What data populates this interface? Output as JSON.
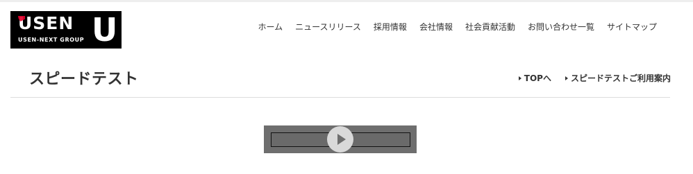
{
  "logo": {
    "brand": "USEN",
    "group": "USEN-NEXT GROUP",
    "mark": "U",
    "accent_color": "#e4002b"
  },
  "nav": {
    "items": [
      {
        "label": "ホーム"
      },
      {
        "label": "ニュースリリース"
      },
      {
        "label": "採用情報"
      },
      {
        "label": "会社情報"
      },
      {
        "label": "社会貢献活動"
      },
      {
        "label": "お問い合わせ一覧"
      },
      {
        "label": "サイトマップ"
      }
    ]
  },
  "page": {
    "title": "スピードテスト",
    "links": [
      {
        "label": "TOPへ"
      },
      {
        "label": "スピードテストご利用案内"
      }
    ]
  },
  "player": {
    "icon": "play-icon"
  }
}
